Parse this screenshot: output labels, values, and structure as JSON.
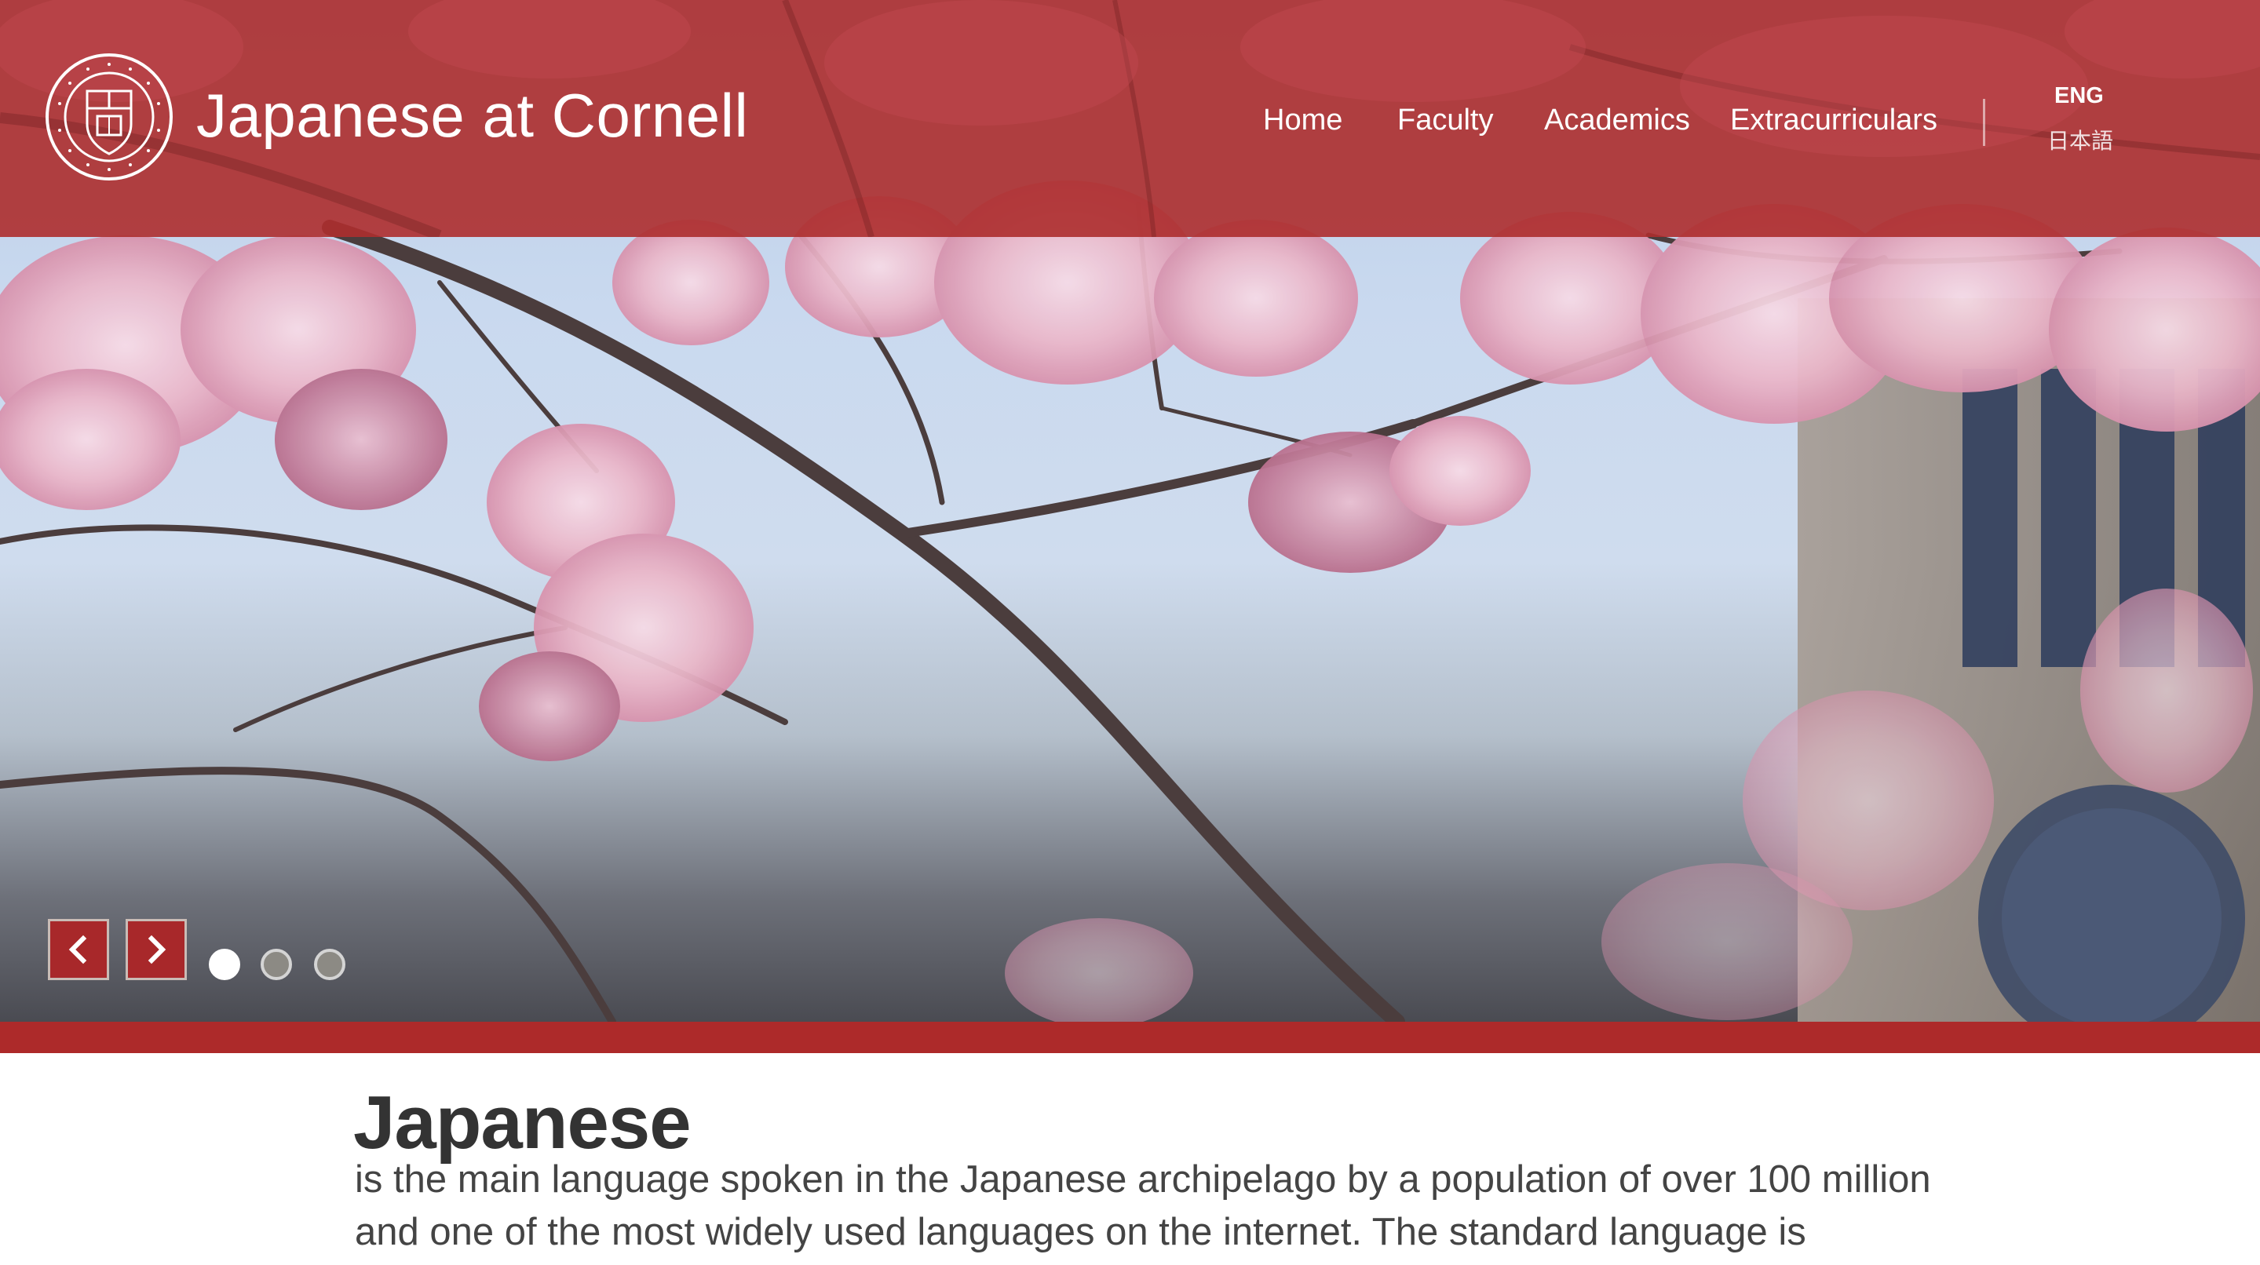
{
  "header": {
    "site_title": "Japanese at Cornell",
    "logo_icon": "cornell-seal-icon",
    "logo_lettering": "CORNELL UNIVERSITY FOUNDED A.D. 1865",
    "nav": [
      {
        "label": "Home"
      },
      {
        "label": "Faculty"
      },
      {
        "label": "Academics"
      },
      {
        "label": "Extracurriculars"
      }
    ],
    "languages": {
      "english": "ENG",
      "japanese": "日本語"
    }
  },
  "slider": {
    "prev_icon": "chevron-left-icon",
    "next_icon": "chevron-right-icon",
    "slide_count": 3,
    "active_slide": 1
  },
  "intro": {
    "title": "Japanese",
    "text": "is the main language spoken in the Japanese archipelago by a population of over 100 million and one of the most widely used languages on the internet. The standard language is characterized,"
  },
  "colors": {
    "brand_red": "#ad2a2a",
    "header_overlay": "#ad2e2e",
    "text_dark": "#333333"
  }
}
